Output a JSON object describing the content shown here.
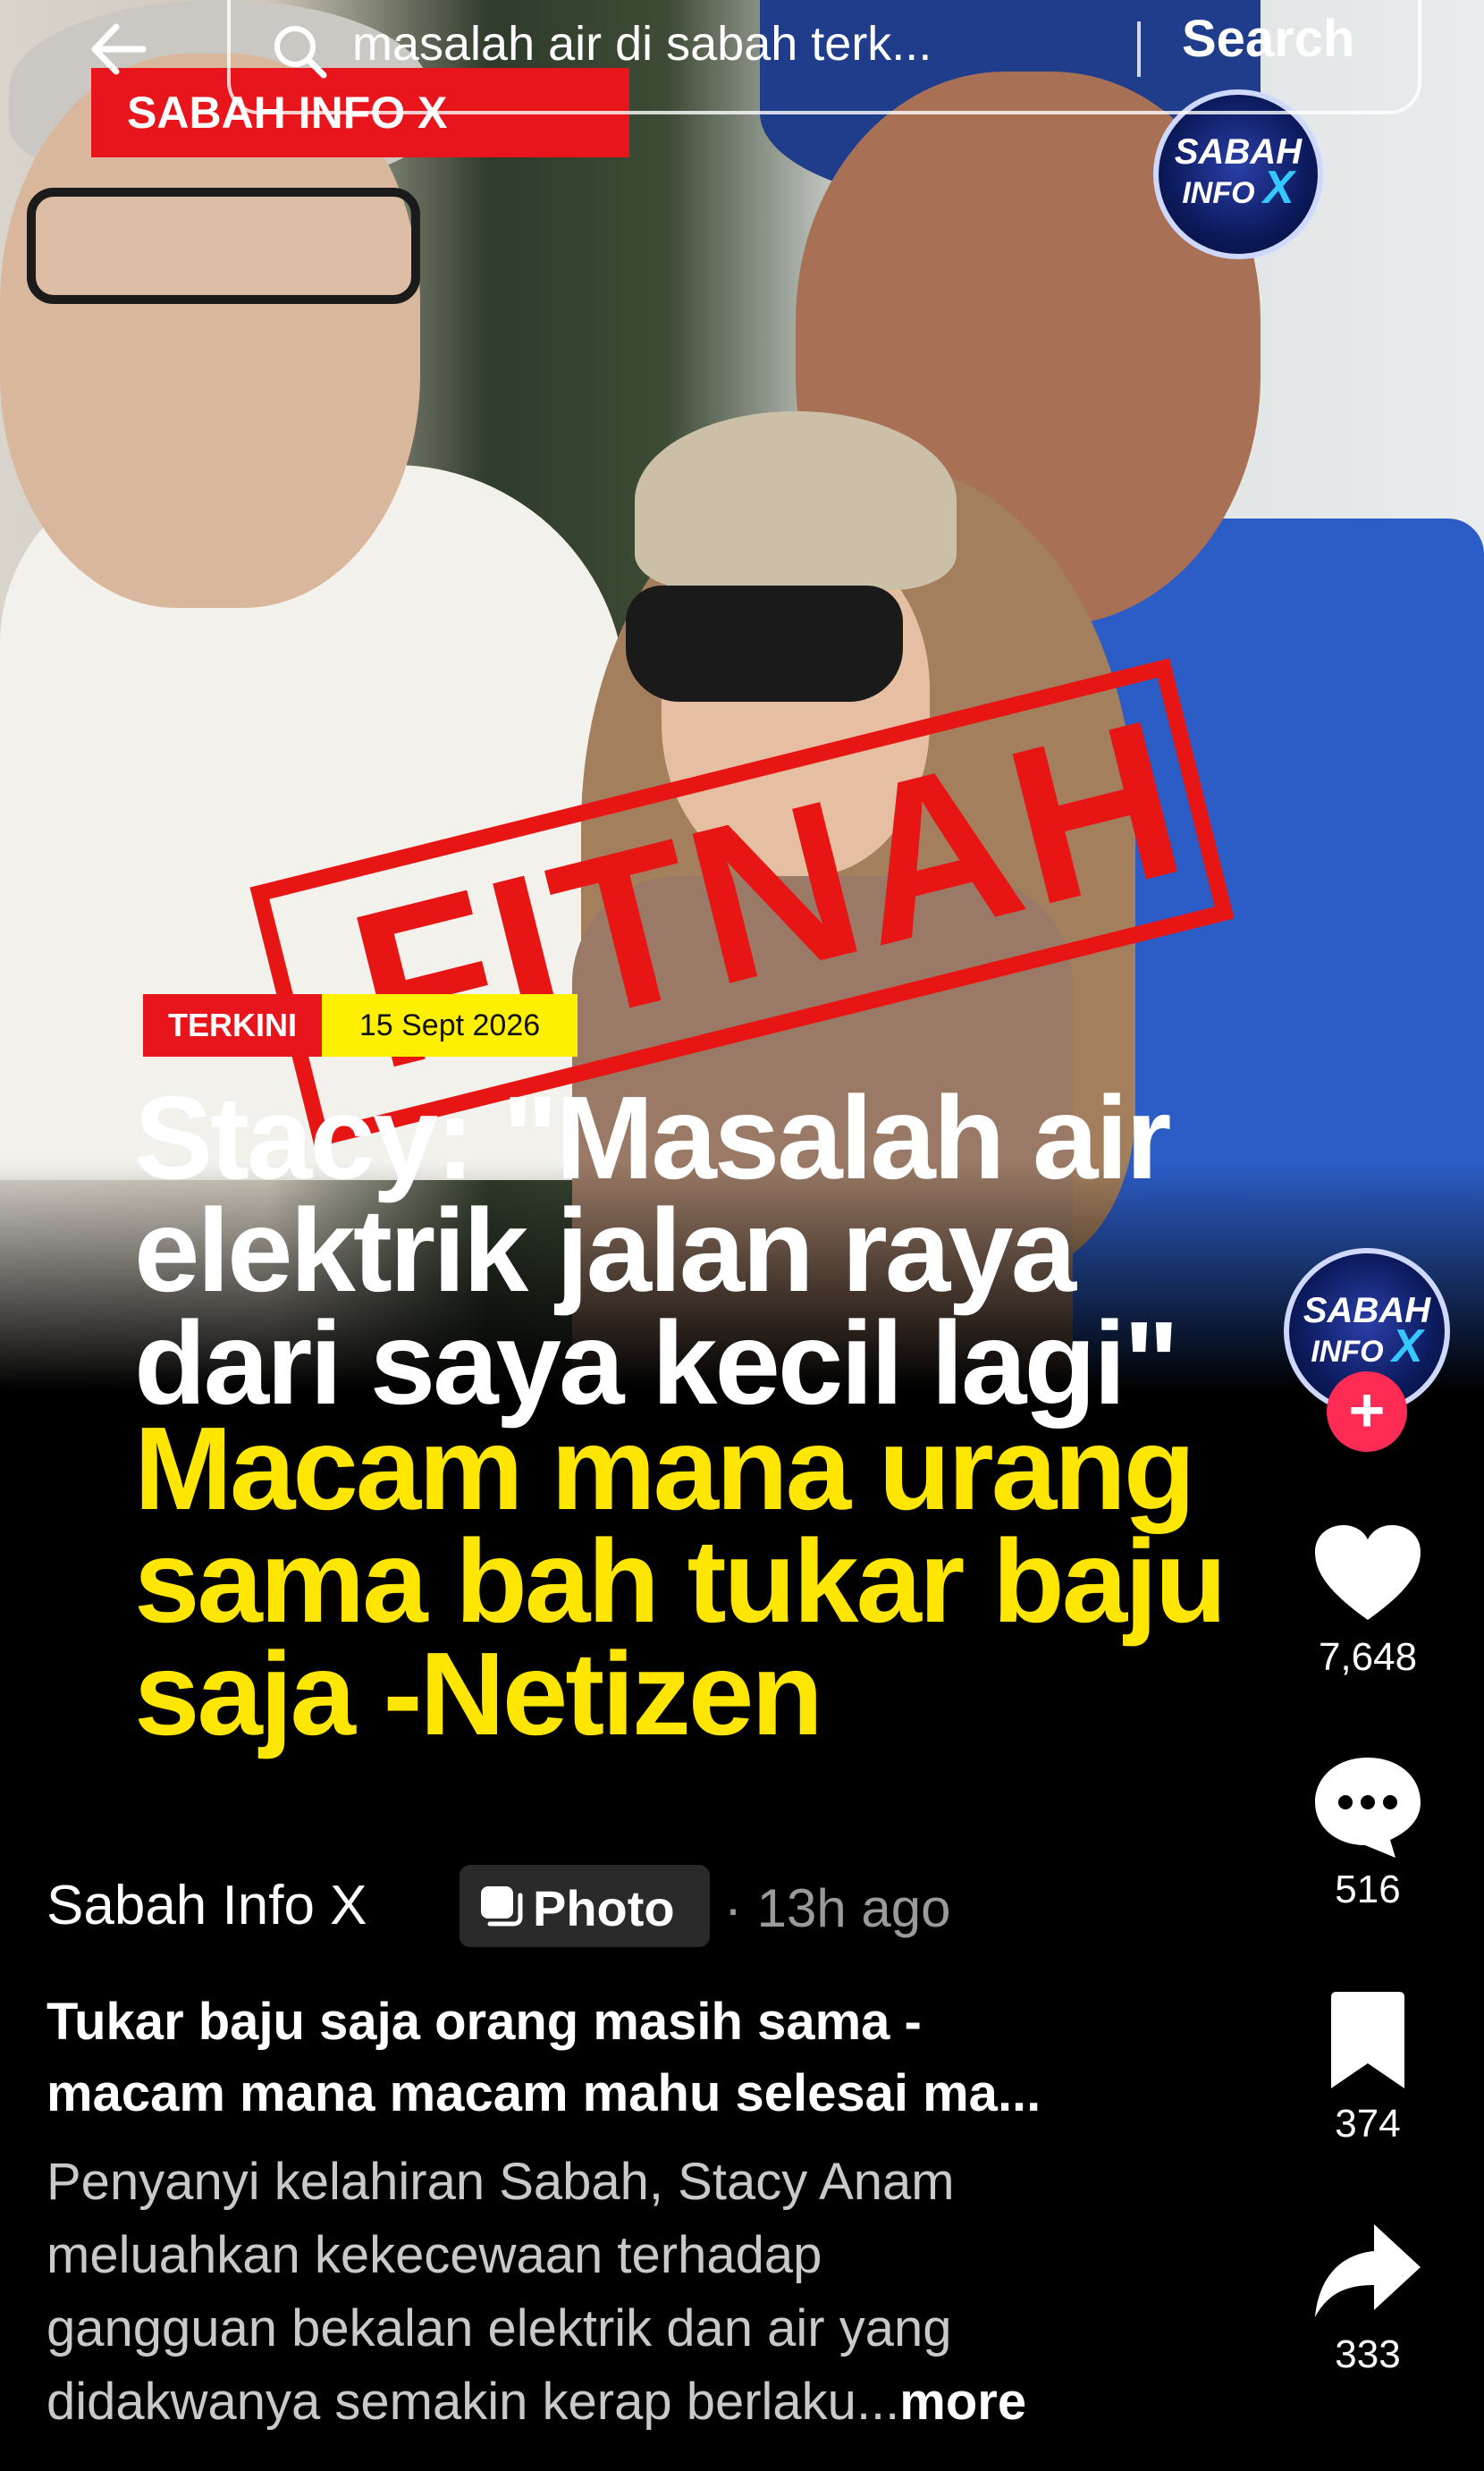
{
  "search": {
    "query": "masalah air di sabah terk...",
    "button_label": "Search"
  },
  "post_image": {
    "channel_banner": "SABAH INFO X",
    "logo": {
      "line1": "SABAH",
      "line2": "INFO",
      "mark": "X"
    },
    "stamp": "FITNAH",
    "badge_category": "TERKINI",
    "badge_date": "15 Sept 2026",
    "headline_lines": [
      "Stacy: \"Masalah air",
      "elektrik jalan raya",
      "dari saya kecil lagi\""
    ],
    "subheadline_lines": [
      "Macam mana urang",
      "sama bah tukar baju",
      "saja -Netizen"
    ]
  },
  "actions": {
    "avatar_logo": {
      "line1": "SABAH",
      "line2": "INFO",
      "mark": "X"
    },
    "likes": "7,648",
    "comments": "516",
    "saves": "374",
    "shares": "333",
    "colors": {
      "follow": "#fe2c55"
    }
  },
  "meta": {
    "author": "Sabah Info X",
    "type_label": "Photo",
    "time": "· 13h ago"
  },
  "caption": {
    "title_lines": [
      "Tukar baju saja orang masih sama -",
      "macam mana macam mahu selesai ma..."
    ],
    "body_lines": [
      "Penyanyi kelahiran Sabah, Stacy Anam",
      "meluahkan kekecewaan terhadap",
      "gangguan bekalan elektrik dan air yang",
      "didakwanya semakin kerap berlaku..."
    ],
    "more_label": "more"
  }
}
